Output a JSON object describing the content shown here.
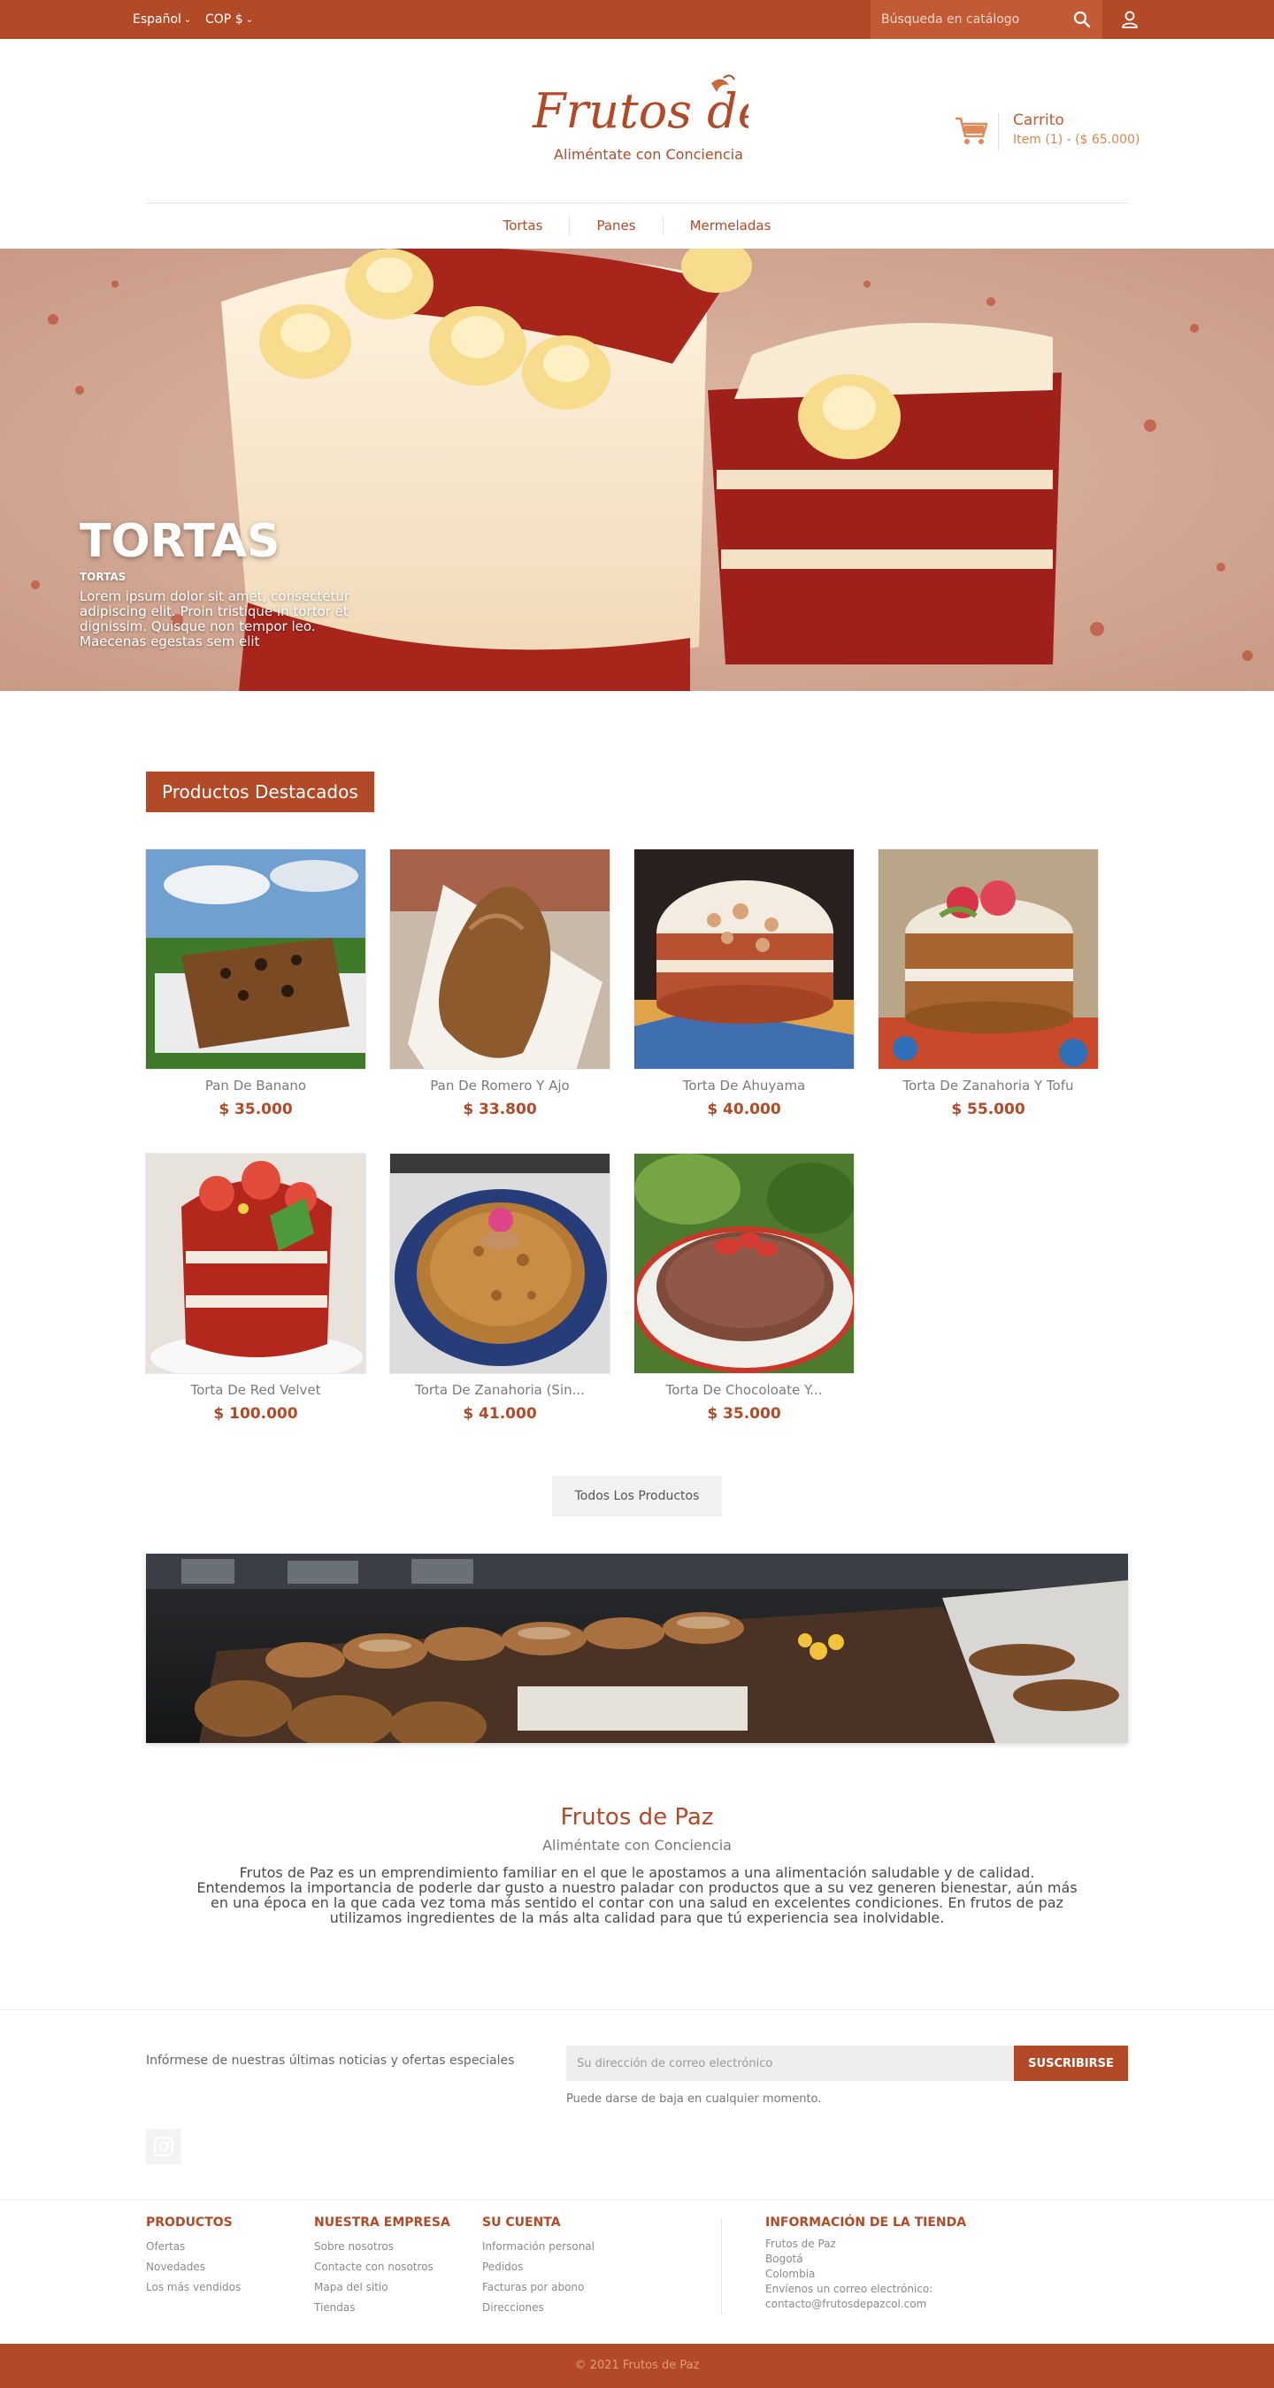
{
  "topbar": {
    "language": "Español",
    "currency": "COP $",
    "search_placeholder": "Búsqueda en catálogo"
  },
  "header": {
    "logo_text": "Frutos de Paz",
    "logo_tagline": "Aliméntate con Conciencia",
    "cart_title": "Carrito",
    "cart_info": "Item (1) - ($ 65.000)"
  },
  "nav": [
    "Tortas",
    "Panes",
    "Mermeladas"
  ],
  "hero": {
    "title": "TORTAS",
    "subtitle": "TORTAS",
    "description": "Lorem ipsum dolor sit amet, consectetur adipiscing elit. Proin tristique in tortor et dignissim. Quisque non tempor leo. Maecenas egestas sem elit"
  },
  "featured": {
    "title": "Productos Destacados",
    "products": [
      {
        "name": "Pan De Banano",
        "price": "$ 35.000"
      },
      {
        "name": "Pan De Romero Y Ajo",
        "price": "$ 33.800"
      },
      {
        "name": "Torta De Ahuyama",
        "price": "$ 40.000"
      },
      {
        "name": "Torta De Zanahoria Y Tofu",
        "price": "$ 55.000"
      },
      {
        "name": "Torta De Red Velvet",
        "price": "$ 100.000"
      },
      {
        "name": "Torta De Zanahoria (Sin...",
        "price": "$ 41.000"
      },
      {
        "name": "Torta De Chocoloate Y...",
        "price": "$ 35.000"
      }
    ],
    "all_button": "Todos Los Productos"
  },
  "about": {
    "title": "Frutos de Paz",
    "subtitle": "Aliméntate con Conciencia",
    "text": "Frutos de Paz es un emprendimiento familiar en el que le apostamos a una alimentación saludable y de calidad. Entendemos la importancia de poderle dar gusto a nuestro paladar con productos que a su vez generen bienestar, aún más en una época en la que cada vez toma más sentido el contar con una salud en excelentes condiciones. En frutos de paz utilizamos ingredientes de la más alta calidad para que tú experiencia sea inolvidable."
  },
  "newsletter": {
    "text": "Infórmese de nuestras últimas noticias y ofertas especiales",
    "placeholder": "Su dirección de correo electrónico",
    "button": "SUSCRIBIRSE",
    "note": "Puede darse de baja en cualquier momento."
  },
  "footer": {
    "products": {
      "title": "PRODUCTOS",
      "links": [
        "Ofertas",
        "Novedades",
        "Los más vendidos"
      ]
    },
    "company": {
      "title": "NUESTRA EMPRESA",
      "links": [
        "Sobre nosotros",
        "Contacte con nosotros",
        "Mapa del sitio",
        "Tiendas"
      ]
    },
    "account": {
      "title": "SU CUENTA",
      "links": [
        "Información personal",
        "Pedidos",
        "Facturas por abono",
        "Direcciones"
      ]
    },
    "info": {
      "title": "INFORMACIÓN DE LA TIENDA",
      "lines": [
        "Frutos de Paz",
        "Bogotá",
        "Colombia",
        "Envíenos un correo electrónico:",
        "contacto@frutosdepazcol.com"
      ]
    },
    "copyright": "© 2021 Frutos de Paz"
  },
  "colors": {
    "accent": "#b34a27",
    "accent_light": "#d7864a",
    "bottom_text": "#e49b72"
  }
}
